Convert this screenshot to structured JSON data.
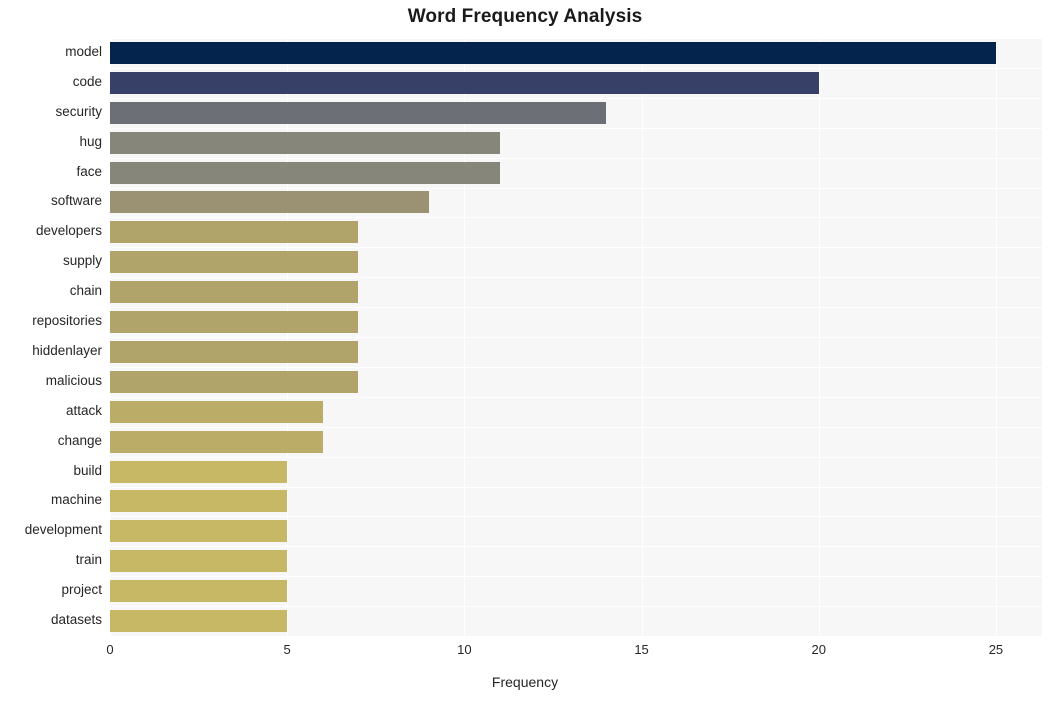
{
  "chart_data": {
    "type": "bar",
    "orientation": "horizontal",
    "title": "Word Frequency Analysis",
    "xlabel": "Frequency",
    "ylabel": "",
    "xlim": [
      0,
      26.3
    ],
    "xticks": [
      0,
      5,
      10,
      15,
      20,
      25
    ],
    "xtick_labels": [
      "0",
      "5",
      "10",
      "15",
      "20",
      "25"
    ],
    "grid": true,
    "grid_color": "#ffffff",
    "plot_background": "#f7f7f7",
    "legend": null,
    "categories": [
      "model",
      "code",
      "security",
      "hug",
      "face",
      "software",
      "developers",
      "supply",
      "chain",
      "repositories",
      "hiddenlayer",
      "malicious",
      "attack",
      "change",
      "build",
      "machine",
      "development",
      "train",
      "project",
      "datasets"
    ],
    "values": [
      25,
      20,
      14,
      11,
      11,
      9,
      7,
      7,
      7,
      7,
      7,
      7,
      6,
      6,
      5,
      5,
      5,
      5,
      5,
      5
    ],
    "bar_colors": [
      "#05244d",
      "#374167",
      "#6c6f75",
      "#87867a",
      "#87867a",
      "#9a9272",
      "#b1a46b",
      "#b1a46b",
      "#b1a46b",
      "#b1a46b",
      "#b1a46b",
      "#b1a46b",
      "#bbac68",
      "#bbac68",
      "#c6b865",
      "#c6b865",
      "#c6b865",
      "#c6b865",
      "#c6b865",
      "#c6b865"
    ]
  }
}
